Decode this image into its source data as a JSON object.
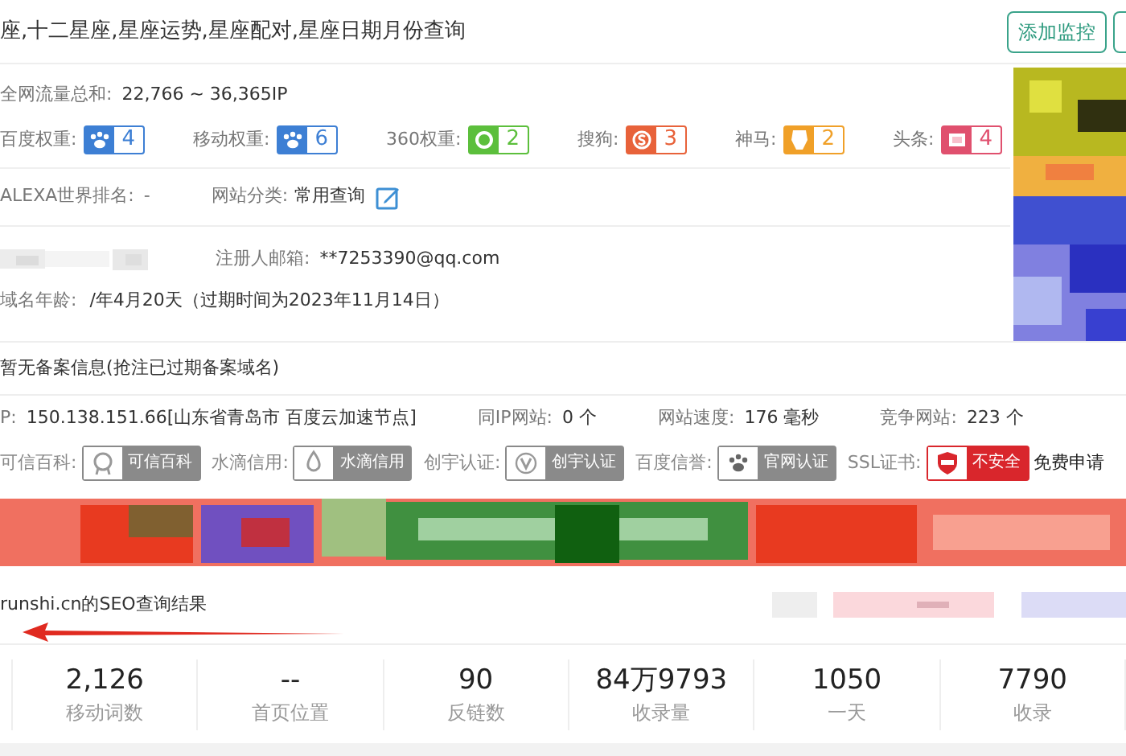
{
  "header": {
    "title": "座,十二星座,星座运势,星座配对,星座日期月份查询",
    "button": "添加监控"
  },
  "traffic": {
    "label": "全网流量总和:",
    "value": "22,766 ~ 36,365IP"
  },
  "weights": [
    {
      "label": "百度权重:",
      "value": "4",
      "color": "#3d7fd4",
      "kind": "paw"
    },
    {
      "label": "移动权重:",
      "value": "6",
      "color": "#3d7fd4",
      "kind": "paw"
    },
    {
      "label": "360权重:",
      "value": "2",
      "color": "#5cbf3c",
      "kind": "ring"
    },
    {
      "label": "搜狗:",
      "value": "3",
      "color": "#e8623a",
      "kind": "letter"
    },
    {
      "label": "神马:",
      "value": "2",
      "color": "#f0a028",
      "kind": "horse"
    },
    {
      "label": "头条:",
      "value": "4",
      "color": "#e0506e",
      "kind": "square"
    }
  ],
  "alexa": {
    "label": "ALEXA世界排名:",
    "value": "-"
  },
  "category": {
    "label": "网站分类:",
    "value": "常用查询"
  },
  "email": {
    "label": "注册人邮箱:",
    "value": "**7253390@qq.com"
  },
  "domain_age": {
    "label": "域名年龄:",
    "value": "/年4月20天（过期时间为2023年11月14日）"
  },
  "record": "暂无备案信息(抢注已过期备案域名)",
  "server": [
    {
      "label": "P:",
      "value": "150.138.151.66[山东省青岛市 百度云加速节点]"
    },
    {
      "label": "同IP网站:",
      "value": "0 个"
    },
    {
      "label": "网站速度:",
      "value": "176 毫秒"
    },
    {
      "label": "竞争网站:",
      "value": "223 个"
    }
  ],
  "certs": [
    {
      "label": "可信百科:",
      "badge": "可信百科",
      "color": "#8a8a8a",
      "kind": "medal"
    },
    {
      "label": "水滴信用:",
      "badge": "水滴信用",
      "color": "#8a8a8a",
      "kind": "drop"
    },
    {
      "label": "创宇认证:",
      "badge": "创宇认证",
      "color": "#8a8a8a",
      "kind": "v"
    },
    {
      "label": "百度信誉:",
      "badge": "官网认证",
      "color": "#8a8a8a",
      "kind": "paw"
    },
    {
      "label": "SSL证书:",
      "badge": "不安全",
      "color": "#d9262c",
      "kind": "shield"
    }
  ],
  "ssl_link": "免费申请",
  "seo_title": "runshi.cn的SEO查询结果",
  "stats": [
    {
      "value": "2,126",
      "label": "移动词数"
    },
    {
      "value": "--",
      "label": "首页位置"
    },
    {
      "value": "90",
      "label": "反链数"
    },
    {
      "value": "84万9793",
      "label": "收录量"
    },
    {
      "value": "1050",
      "label": "一天"
    },
    {
      "value": "7790",
      "label": "收录"
    }
  ]
}
